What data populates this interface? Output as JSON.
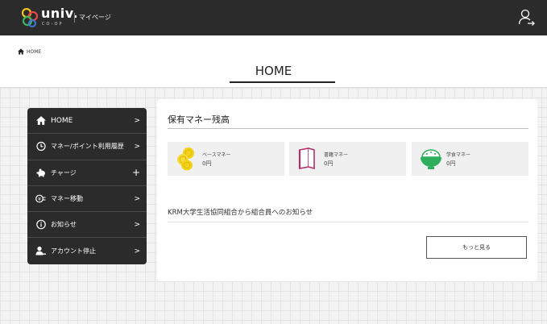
{
  "header": {
    "brand": "univ.",
    "brand_sub": "CO-OP",
    "page_name": "マイページ",
    "user_icon": "user-arrow-icon"
  },
  "breadcrumb": {
    "icon": "home-icon",
    "label": "HOME"
  },
  "page": {
    "title": "HOME"
  },
  "sidebar": {
    "items": [
      {
        "label": "HOME",
        "icon": "home-icon",
        "indicator": ">"
      },
      {
        "label": "マネー/ポイント利用履歴",
        "icon": "clock-icon",
        "indicator": ">"
      },
      {
        "label": "チャージ",
        "icon": "piggy-bank-icon",
        "indicator": "+"
      },
      {
        "label": "マネー移動",
        "icon": "money-transfer-icon",
        "indicator": ">"
      },
      {
        "label": "お知らせ",
        "icon": "info-icon",
        "indicator": ">"
      },
      {
        "label": "アカウント停止",
        "icon": "user-stop-icon",
        "indicator": ">"
      }
    ]
  },
  "main": {
    "balance_heading": "保有マネー残高",
    "balances": [
      {
        "label": "ベースマネー",
        "value": "0円",
        "icon": "coins-icon",
        "color": "#f2d21b"
      },
      {
        "label": "書籍マネー",
        "value": "0円",
        "icon": "book-icon",
        "color": "#b3306b"
      },
      {
        "label": "学食マネー",
        "value": "0円",
        "icon": "rice-bowl-icon",
        "color": "#2fae5e"
      }
    ],
    "notice_heading": "KRM大学生活協同組合から組合員へのお知らせ",
    "more_button": "もっと見る"
  }
}
